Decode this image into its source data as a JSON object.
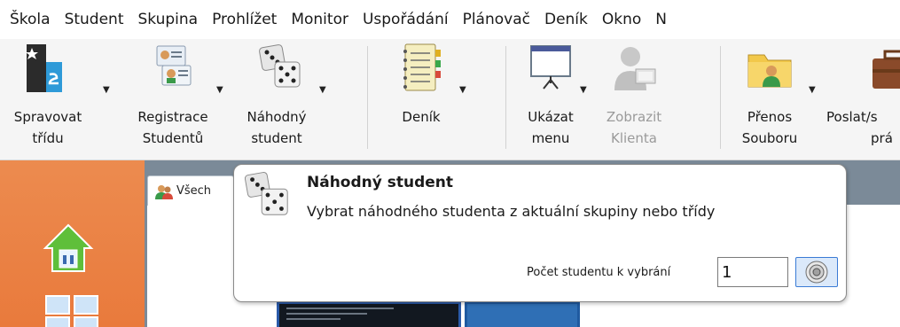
{
  "menubar": {
    "items": [
      "Škola",
      "Student",
      "Skupina",
      "Prohlížet",
      "Monitor",
      "Uspořádání",
      "Plánovač",
      "Deník",
      "Okno",
      "N"
    ]
  },
  "toolbar": {
    "buttons": [
      {
        "line1": "Spravovat",
        "line2": "třídu",
        "icon": "class-board-icon"
      },
      {
        "line1": "Registrace",
        "line2": "Studentů",
        "icon": "id-card-icon"
      },
      {
        "line1": "Náhodný",
        "line2": "student",
        "icon": "dice-icon"
      },
      {
        "line1": "Deník",
        "line2": "",
        "icon": "journal-icon"
      },
      {
        "line1": "Ukázat",
        "line2": "menu",
        "icon": "projector-icon"
      },
      {
        "line1": "Zobrazit",
        "line2": "Klienta",
        "icon": "client-icon",
        "disabled": true
      },
      {
        "line1": "Přenos",
        "line2": "Souboru",
        "icon": "folder-user-icon"
      },
      {
        "line1": "Poslat/s",
        "line2": "prá",
        "icon": "briefcase-icon"
      }
    ]
  },
  "tab": {
    "label": "Všech"
  },
  "popup": {
    "title": "Náhodný student",
    "description": "Vybrat náhodného studenta z aktuální skupiny nebo třídy",
    "count_label": "Počet studentu k vybrání",
    "count_value": "1"
  },
  "colors": {
    "sidebar": "#e97a3c",
    "workspace": "#7b8a98",
    "toolbar": "#f5f5f5",
    "accent_blue": "#3a7bd5"
  }
}
